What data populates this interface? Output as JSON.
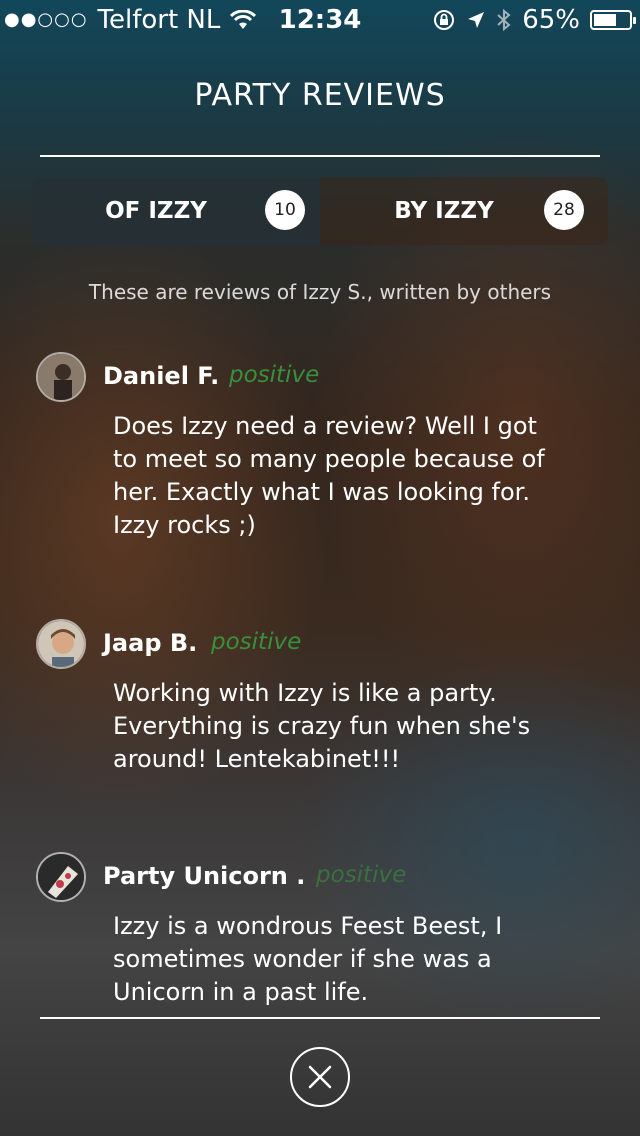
{
  "status_bar": {
    "carrier": "Telfort NL",
    "time": "12:34",
    "battery_percent": "65%",
    "battery_level": 0.65,
    "icons": [
      "signal-dots-icon",
      "wifi-icon",
      "rotation-lock-icon",
      "location-arrow-icon",
      "bluetooth-icon",
      "battery-icon"
    ]
  },
  "header": {
    "title": "PARTY REVIEWS"
  },
  "tabs": [
    {
      "label": "OF IZZY",
      "count": "10",
      "active": true
    },
    {
      "label": "BY IZZY",
      "count": "28",
      "active": false
    }
  ],
  "subtitle": "These are reviews of Izzy S., written by others",
  "reviews": [
    {
      "name": "Daniel F.",
      "sentiment": "positive",
      "text": "Does Izzy need a review? Well I got to meet so many people because of her. Exactly what I was looking for. Izzy rocks ;)"
    },
    {
      "name": "Jaap B.",
      "sentiment": "positive",
      "text": "Working with Izzy is like a party. Everything is crazy fun when she's around! Lentekabinet!!!"
    },
    {
      "name": "Party Unicorn  .",
      "sentiment": "positive",
      "text": "Izzy is a wondrous Feest Beest, I sometimes wonder if she was a Unicorn in a past life."
    }
  ],
  "colors": {
    "sentiment_positive": "#3a8f3a",
    "accent": "#ffffff"
  },
  "close_icon": "close-icon"
}
